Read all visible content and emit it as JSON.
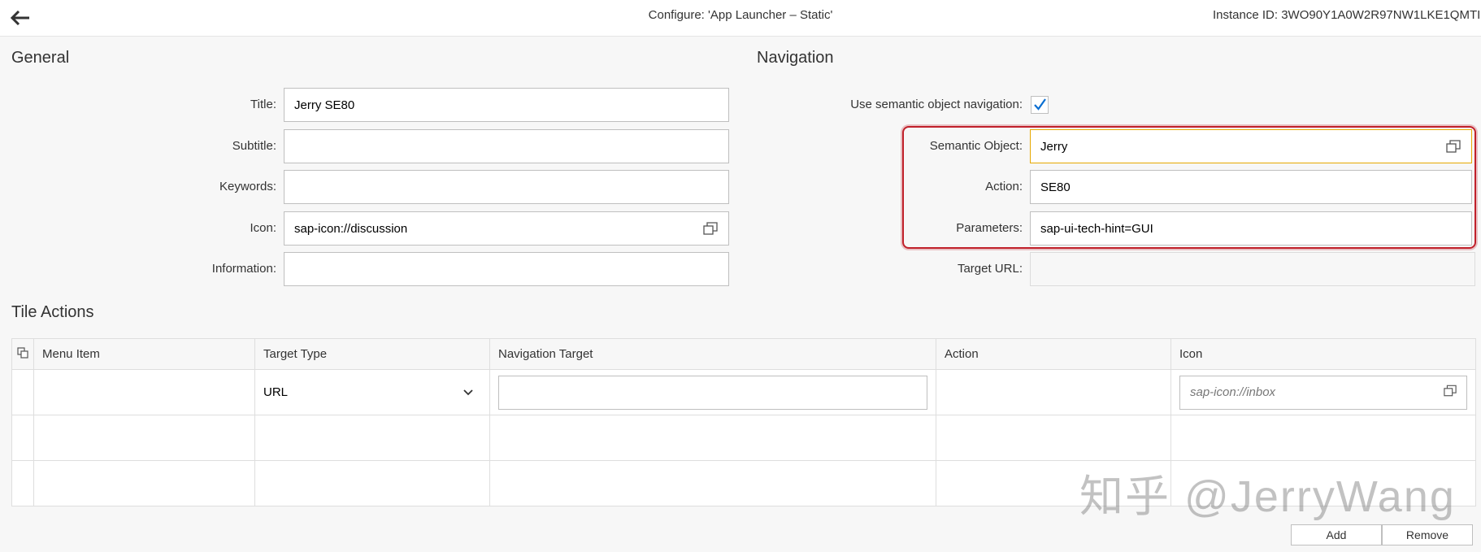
{
  "header": {
    "title": "Configure: 'App Launcher – Static'",
    "instance_id": "Instance ID: 3WO90Y1A0W2R97NW1LKE1QMTI"
  },
  "general": {
    "section_title": "General",
    "fields": {
      "title": {
        "label": "Title:",
        "value": "Jerry SE80"
      },
      "subtitle": {
        "label": "Subtitle:",
        "value": ""
      },
      "keywords": {
        "label": "Keywords:",
        "value": ""
      },
      "icon": {
        "label": "Icon:",
        "value": "sap-icon://discussion"
      },
      "information": {
        "label": "Information:",
        "value": ""
      }
    }
  },
  "navigation": {
    "section_title": "Navigation",
    "semantic_nav_label": "Use semantic object navigation:",
    "semantic_nav_checked": true,
    "fields": {
      "semantic_object": {
        "label": "Semantic Object:",
        "value": "Jerry"
      },
      "action": {
        "label": "Action:",
        "value": "SE80"
      },
      "parameters": {
        "label": "Parameters:",
        "value": "sap-ui-tech-hint=GUI"
      },
      "target_url": {
        "label": "Target URL:",
        "value": ""
      }
    }
  },
  "tile_actions": {
    "section_title": "Tile Actions",
    "columns": [
      "Menu Item",
      "Target Type",
      "Navigation Target",
      "Action",
      "Icon"
    ],
    "rows": [
      {
        "menu_item": "",
        "target_type": "URL",
        "navigation_target": "",
        "action": "",
        "icon_placeholder": "sap-icon://inbox"
      }
    ],
    "add_label": "Add",
    "remove_label": "Remove"
  },
  "watermark": "知乎 @JerryWang",
  "colors": {
    "highlight": "#c0202a",
    "focus_border": "#e6a800",
    "check": "#0a6ed1"
  },
  "icons": {
    "back": "arrow-left-icon",
    "value_help": "value-help-icon",
    "dropdown": "chevron-down-icon",
    "column_settings": "column-settings-icon"
  }
}
